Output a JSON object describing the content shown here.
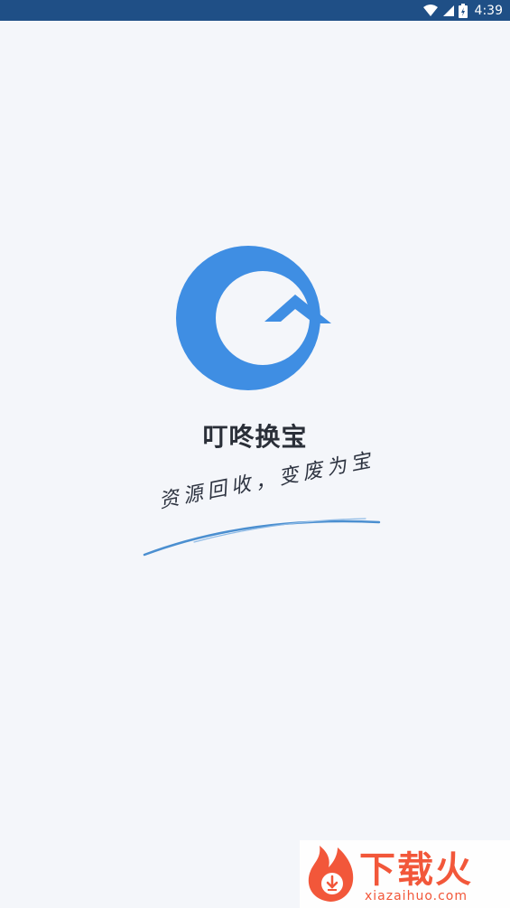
{
  "status_bar": {
    "time": "4:39",
    "icons": [
      "wifi-icon",
      "signal-icon",
      "battery-icon"
    ]
  },
  "app": {
    "name": "叮咚换宝",
    "slogan": "资源回收，变废为宝",
    "logo_icon": "recycle-arrow-logo-icon",
    "brand_color": "#3f8ee3"
  },
  "watermark": {
    "title": "下载火",
    "url": "xiazaihuo.com",
    "color": "#f24a2a"
  }
}
